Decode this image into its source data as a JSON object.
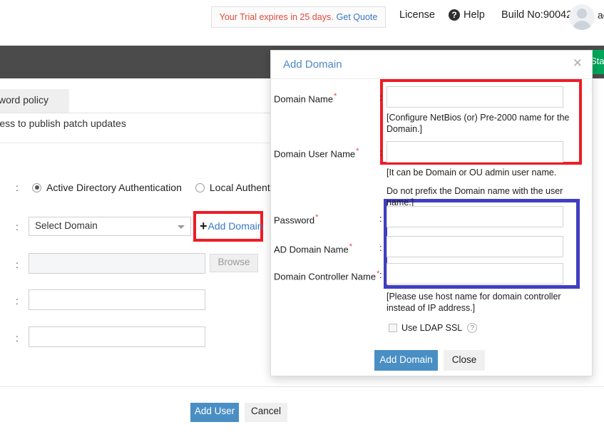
{
  "topbar": {
    "trial_text": "Your Trial expires in 25 days.",
    "trial_link": "Get Quote",
    "license": "License",
    "help": "Help",
    "help_icon": "question-circle-icon",
    "build": "Build No:90042",
    "account": "ac",
    "avatar_icon": "user-avatar-icon"
  },
  "background": {
    "green_button": "Star",
    "tab_active": "word policy",
    "subtitle": "vide access to publish patch updates",
    "auth": {
      "option_ad": "Active Directory Authentication",
      "option_local": "Local Authenticatio",
      "selected": "Active Directory Authentication"
    },
    "domain_select": {
      "value": "Select Domain",
      "caret_icon": "chevron-down-icon"
    },
    "add_domain_link": "Add Domain",
    "add_domain_plus_icon": "plus-icon",
    "browse_button": "Browse",
    "field_value_1": "",
    "field_value_2": "",
    "field_value_3": "",
    "colon": ":"
  },
  "footer": {
    "add_user": "Add User",
    "cancel": "Cancel"
  },
  "modal": {
    "title": "Add Domain",
    "close_icon": "close-icon",
    "colon": ":",
    "required_mark": "*",
    "fields": [
      {
        "label": "Domain Name",
        "value": "",
        "required": true
      },
      {
        "label": "Domain User Name",
        "value": "",
        "required": true
      },
      {
        "label": "Password",
        "value": "",
        "required": true
      },
      {
        "label": "AD Domain Name",
        "value": "",
        "required": true
      },
      {
        "label": "Domain Controller Name",
        "value": "",
        "required": true
      }
    ],
    "hints": {
      "domain_name": "[Configure NetBios (or) Pre-2000 name for the Domain.]",
      "domain_user_line1": "[It can be Domain or OU admin user name.",
      "domain_user_line2": "Do not prefix the Domain name with the user name.]",
      "domain_controller": "[Please use host name for domain controller instead of IP address.]"
    },
    "ldap": {
      "label": "Use LDAP SSL",
      "checked": false,
      "help_icon": "question-mark-icon"
    },
    "buttons": {
      "submit": "Add Domain",
      "close": "Close"
    }
  },
  "highlights": {
    "red": "#ee1c25",
    "blue": "#3f3fc0"
  },
  "colors": {
    "accent_blue": "#4a8fc4",
    "link_blue": "#3a78c3",
    "dark_band": "#4b4b4b",
    "green": "#00a65a",
    "trial_red": "#e24a3b"
  }
}
